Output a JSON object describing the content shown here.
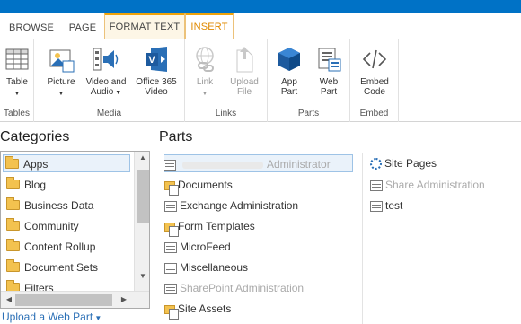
{
  "tabs": [
    "BROWSE",
    "PAGE",
    "FORMAT TEXT",
    "INSERT"
  ],
  "ribbon": {
    "groups": {
      "tables": "Tables",
      "media": "Media",
      "links": "Links",
      "parts": "Parts",
      "embed": "Embed"
    },
    "buttons": {
      "table": "Table",
      "picture": "Picture",
      "video_audio_1": "Video and",
      "video_audio_2": "Audio",
      "office365_1": "Office 365",
      "office365_2": "Video",
      "link": "Link",
      "upload_1": "Upload",
      "upload_2": "File",
      "app_1": "App",
      "app_2": "Part",
      "web_1": "Web",
      "web_2": "Part",
      "embed_1": "Embed",
      "embed_2": "Code"
    },
    "colors": {
      "accent": "#0072c6",
      "active_tab": "#f0a30a",
      "icon_blue": "#2a6fb6"
    }
  },
  "categories": {
    "title": "Categories",
    "items": [
      "Apps",
      "Blog",
      "Business Data",
      "Community",
      "Content Rollup",
      "Document Sets",
      "Filters"
    ],
    "selected": "Apps"
  },
  "parts": {
    "title": "Parts",
    "column1": [
      {
        "label": "Administrator",
        "icon": "list-icon"
      },
      {
        "label": "Documents",
        "icon": "library-icon"
      },
      {
        "label": "Exchange Administration",
        "icon": "list-icon"
      },
      {
        "label": "Form Templates",
        "icon": "library-icon"
      },
      {
        "label": "MicroFeed",
        "icon": "list-icon"
      },
      {
        "label": "Miscellaneous",
        "icon": "list-icon"
      },
      {
        "label": "SharePoint Administration",
        "icon": "list-icon"
      },
      {
        "label": "Site Assets",
        "icon": "library-icon"
      }
    ],
    "column2": [
      {
        "label": "Site Pages",
        "icon": "site-pages-icon"
      },
      {
        "label": "Share Administration",
        "icon": "list-icon"
      },
      {
        "label": "test",
        "icon": "list-icon"
      }
    ]
  },
  "upload_link": "Upload a Web Part"
}
